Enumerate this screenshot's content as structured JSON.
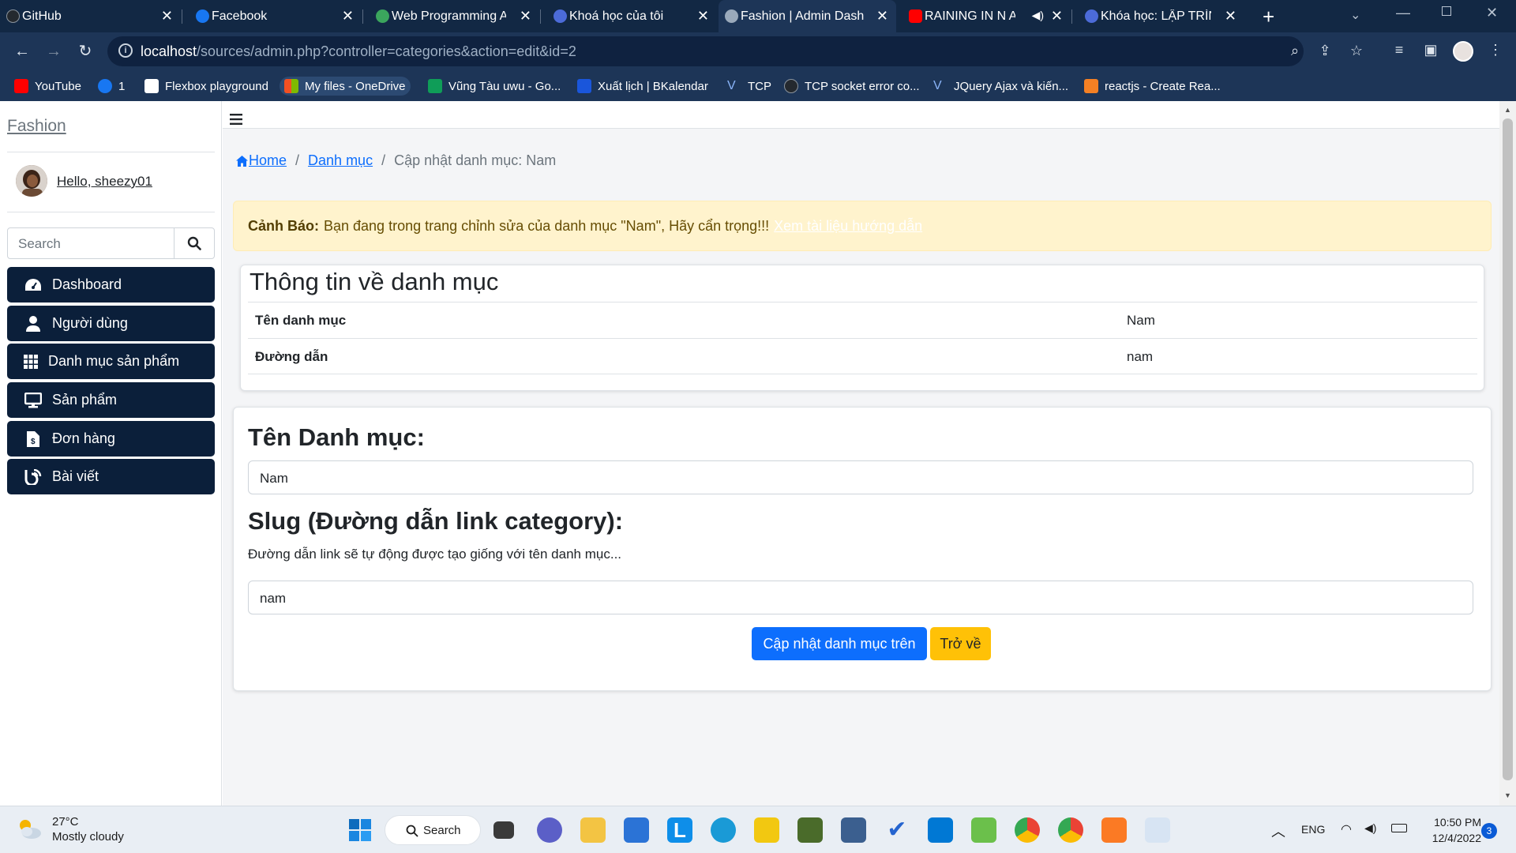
{
  "browser": {
    "tabs": [
      {
        "title": "GitHub"
      },
      {
        "title": "Facebook"
      },
      {
        "title": "Web Programming As"
      },
      {
        "title": "Khoá học của tôi"
      },
      {
        "title": "Fashion | Admin Dash"
      },
      {
        "title": "RAINING IN N A"
      },
      {
        "title": "Khóa học: LẬP TRÌNH"
      }
    ],
    "url_host": "localhost",
    "url_path": "/sources/admin.php?controller=categories&action=edit&id=2",
    "bookmarks": [
      {
        "label": "YouTube"
      },
      {
        "label": "1"
      },
      {
        "label": "Flexbox playground"
      },
      {
        "label": "My files - OneDrive"
      },
      {
        "label": "Vũng Tàu uwu - Go..."
      },
      {
        "label": "Xuất lịch | BKalendar"
      },
      {
        "label": "TCP"
      },
      {
        "label": "TCP socket error co..."
      },
      {
        "label": "JQuery Ajax và kiến..."
      },
      {
        "label": "reactjs - Create Rea..."
      }
    ]
  },
  "sidebar": {
    "brand": "Fashion",
    "greeting": "Hello, sheezy01",
    "search_placeholder": "Search",
    "menu": [
      {
        "label": "Dashboard",
        "icon": "tachometer-icon"
      },
      {
        "label": "Người dùng",
        "icon": "user-icon"
      },
      {
        "label": "Danh mục sản phẩm",
        "icon": "grid-icon"
      },
      {
        "label": "Sản phẩm",
        "icon": "desktop-icon"
      },
      {
        "label": "Đơn hàng",
        "icon": "invoice-icon"
      },
      {
        "label": "Bài viết",
        "icon": "blog-icon"
      }
    ]
  },
  "breadcrumb": {
    "home": "Home",
    "section": "Danh mục",
    "current": "Cập nhật danh mục: Nam"
  },
  "alert": {
    "prefix": "Cảnh Báo:",
    "message": "Bạn đang trong trang chỉnh sửa của danh mục \"Nam\", Hãy cẩn trọng!!!",
    "link": "Xem tài liệu hướng dẫn"
  },
  "info": {
    "title": "Thông tin về danh mục",
    "rows": [
      {
        "label": "Tên danh mục",
        "value": "Nam"
      },
      {
        "label": "Đường dẫn",
        "value": "nam"
      }
    ]
  },
  "form": {
    "name_label": "Tên Danh mục:",
    "name_value": "Nam",
    "slug_label": "Slug (Đường dẫn link category):",
    "slug_help": "Đường dẫn link sẽ tự động được tạo giống với tên danh mục...",
    "slug_value": "nam",
    "submit_label": "Cập nhật danh mục trên",
    "back_label": "Trở về"
  },
  "taskbar": {
    "temperature": "27°C",
    "weather": "Mostly cloudy",
    "search_label": "Search",
    "language": "ENG",
    "time": "10:50 PM",
    "date": "12/4/2022",
    "notifications": "3"
  },
  "colors": {
    "primary": "#0d6efd",
    "warning": "#ffc107",
    "sidebar_menu": "#0b1f3a",
    "alert_bg": "#fff3cd"
  }
}
